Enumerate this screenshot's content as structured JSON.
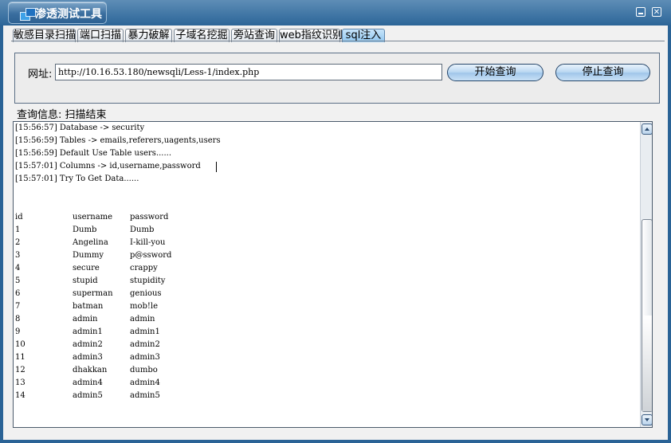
{
  "window": {
    "title": "渗透测试工具"
  },
  "tabs": [
    {
      "label": "敏感目录扫描",
      "active": false
    },
    {
      "label": "端口扫描",
      "active": false
    },
    {
      "label": "暴力破解",
      "active": false
    },
    {
      "label": "子域名挖掘",
      "active": false
    },
    {
      "label": "旁站查询",
      "active": false
    },
    {
      "label": "web指纹识别",
      "active": false
    },
    {
      "label": "sql注入",
      "active": true
    }
  ],
  "url": {
    "label": "网址:",
    "value": "http://10.16.53.180/newsqli/Less-1/index.php"
  },
  "buttons": {
    "start": "开始查询",
    "stop": "停止查询"
  },
  "status": {
    "label": "查询信息:",
    "value": "扫描结束"
  },
  "log": [
    "[15:56:57] Database -> security",
    "[15:56:59] Tables -> emails,referers,uagents,users",
    "[15:56:59] Default Use Table users......",
    "[15:57:01] Columns -> id,username,password",
    "[15:57:01] Try To Get Data......"
  ],
  "table": {
    "headers": [
      "id",
      "username",
      "password"
    ],
    "rows": [
      [
        "1",
        "Dumb",
        "Dumb"
      ],
      [
        "2",
        "Angelina",
        "I-kill-you"
      ],
      [
        "3",
        "Dummy",
        "p@ssword"
      ],
      [
        "4",
        "secure",
        "crappy"
      ],
      [
        "5",
        "stupid",
        "stupidity"
      ],
      [
        "6",
        "superman",
        "genious"
      ],
      [
        "7",
        "batman",
        "mob!le"
      ],
      [
        "8",
        "admin",
        "admin"
      ],
      [
        "9",
        "admin1",
        "admin1"
      ],
      [
        "10",
        "admin2",
        "admin2"
      ],
      [
        "11",
        "admin3",
        "admin3"
      ],
      [
        "12",
        "dhakkan",
        "dumbo"
      ],
      [
        "13",
        "admin4",
        "admin4"
      ],
      [
        "14",
        "admin5",
        "admin5"
      ]
    ]
  },
  "icons": {
    "app": "app-window-icon",
    "minimize": "minimize-icon",
    "close": "close-icon",
    "scroll_up": "chevron-up-icon",
    "scroll_down": "chevron-down-icon"
  },
  "colors": {
    "titlebar": "#2f689a",
    "active_tab": "#8fc6ef",
    "button": "#b8d6f1"
  }
}
